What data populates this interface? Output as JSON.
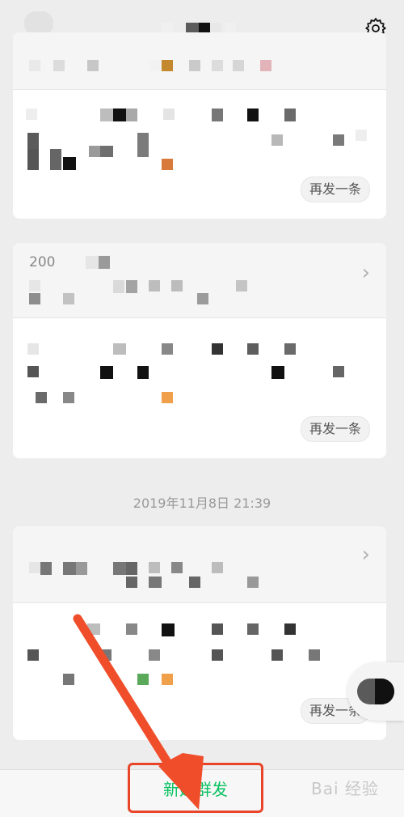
{
  "header": {
    "settings_icon": "gear-icon"
  },
  "cards": [
    {
      "resend_label": "再发一条"
    },
    {
      "label": "200",
      "chevron": "›",
      "resend_label": "再发一条"
    },
    {
      "label": "",
      "chevron": "›",
      "resend_label": "再发一条"
    }
  ],
  "timestamp": "2019年11月8日 21:39",
  "bottom": {
    "new_broadcast_label": "新建群发"
  },
  "watermark": "Bai 经验",
  "colors": {
    "accent_green": "#07c160",
    "highlight_red": "#e8452b",
    "background": "#ededed"
  }
}
